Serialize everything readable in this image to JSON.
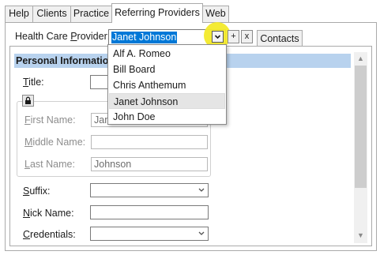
{
  "tabs": [
    "Help",
    "Clients",
    "Practice",
    "Referring Providers",
    "Web"
  ],
  "provider": {
    "label_prefix": "Health Care ",
    "label_accel": "P",
    "label_suffix": "rovider:",
    "selected": "Janet Johnson",
    "add_label": "+",
    "remove_label": "x"
  },
  "contacts_tab": "Contacts",
  "dropdown": {
    "options": [
      "Alf A. Romeo",
      "Bill Board",
      "Chris Anthemum",
      "Janet Johnson",
      "John Doe"
    ],
    "selected_index": 3
  },
  "section": {
    "title": "Personal Information"
  },
  "fields": {
    "title": {
      "accel": "T",
      "rest": "itle:"
    },
    "first_name": {
      "accel": "F",
      "rest": "irst Name:",
      "value": "Janet"
    },
    "middle_name": {
      "accel": "M",
      "rest": "iddle Name:",
      "value": ""
    },
    "last_name": {
      "accel": "L",
      "rest": "ast Name:",
      "value": "Johnson"
    },
    "suffix": {
      "accel": "S",
      "rest": "uffix:",
      "value": ""
    },
    "nick_name": {
      "accel": "N",
      "rest": "ick Name:",
      "value": ""
    },
    "credentials": {
      "accel": "C",
      "rest": "redentials:",
      "value": ""
    }
  },
  "icons": {
    "combo_arrow": "chevron-down-icon",
    "lock": "lock-icon",
    "scroll_up": "arrow-up-icon",
    "scroll_down": "arrow-down-icon"
  },
  "colors": {
    "selection": "#0078d7",
    "section_header": "#b8d2ee",
    "highlight": "#f3ea2a"
  }
}
